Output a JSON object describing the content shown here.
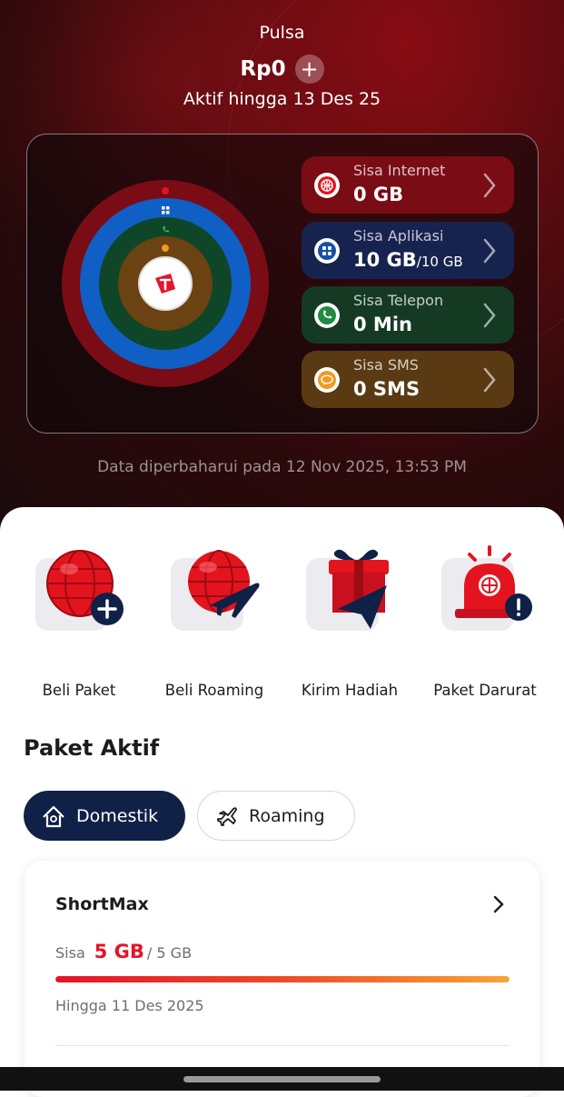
{
  "header": {
    "title": "Pulsa",
    "balance": "Rp0",
    "add_symbol": "+",
    "active_until": "Aktif hingga 13 Des 25"
  },
  "quotas": [
    {
      "label": "Sisa Internet",
      "value": "0 GB",
      "total": "",
      "color": "#7a0c15",
      "icon_bg": "#e3141e",
      "icon": "globe-icon"
    },
    {
      "label": "Sisa Aplikasi",
      "value": "10 GB",
      "total": "/10 GB",
      "color": "#17234f",
      "icon_bg": "#1a4fa8",
      "icon": "apps-icon"
    },
    {
      "label": "Sisa Telepon",
      "value": "0 Min",
      "total": "",
      "color": "#143a24",
      "icon_bg": "#1f8b43",
      "icon": "phone-icon"
    },
    {
      "label": "Sisa SMS",
      "value": "0 SMS",
      "total": "",
      "color": "#5a3a12",
      "icon_bg": "#f29a25",
      "icon": "sms-icon"
    }
  ],
  "updated_text": "Data diperbaharui pada 12 Nov 2025, 13:53 PM",
  "actions": [
    {
      "label": "Beli Paket",
      "icon": "globe-plus-icon"
    },
    {
      "label": "Beli Roaming",
      "icon": "globe-plane-icon"
    },
    {
      "label": "Kirim Hadiah",
      "icon": "gift-icon"
    },
    {
      "label": "Paket Darurat",
      "icon": "siren-icon"
    }
  ],
  "section_title": "Paket Aktif",
  "tabs": [
    {
      "label": "Domestik",
      "active": true
    },
    {
      "label": "Roaming",
      "active": false
    }
  ],
  "package": {
    "name": "ShortMax",
    "remaining_prefix": "Sisa",
    "remaining": "5 GB",
    "total": "/ 5 GB",
    "remaining_fraction": 1.0,
    "until": "Hingga 11 Des 2025"
  },
  "colors": {
    "brand_red": "#e4142a",
    "navy": "#0f2146"
  }
}
